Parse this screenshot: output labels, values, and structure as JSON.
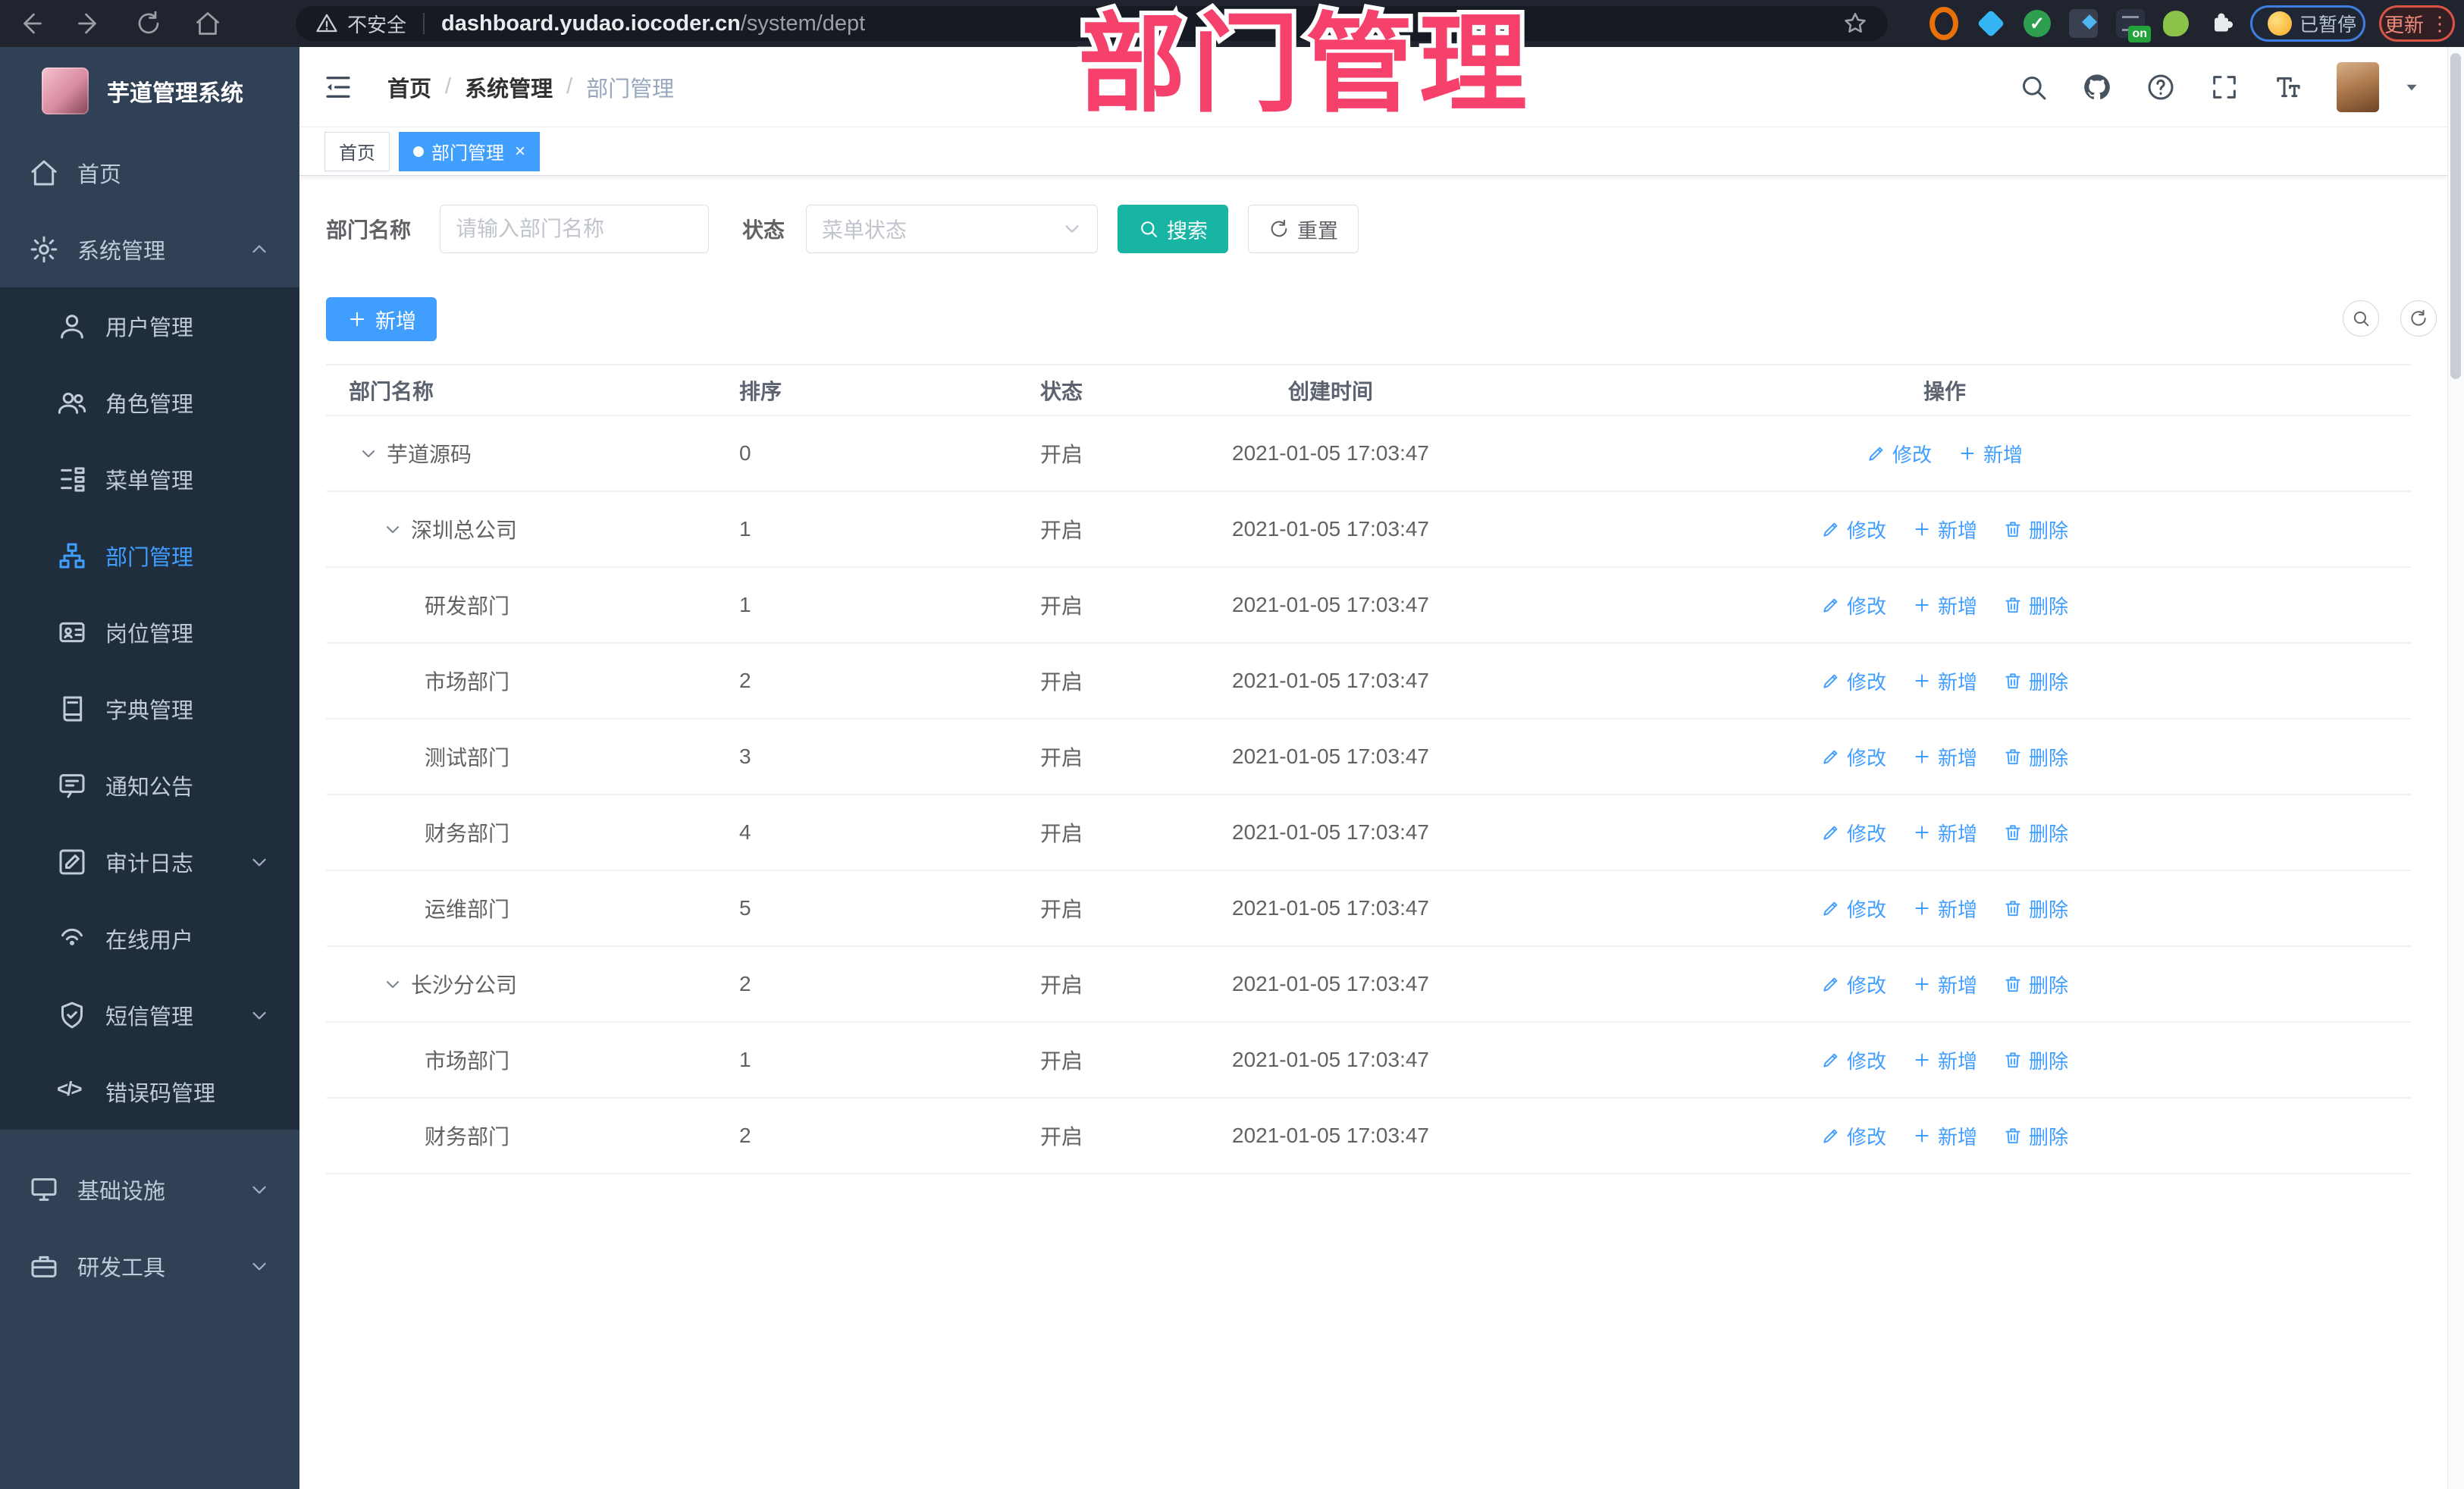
{
  "browser": {
    "security_label": "不安全",
    "url_host": "dashboard.yudao.iocoder.cn",
    "url_path": "/system/dept",
    "paused_label": "已暂停",
    "update_label": "更新",
    "extensions": [
      {
        "name": "orange-ring-extension-icon"
      },
      {
        "name": "blue-gem-extension-icon"
      },
      {
        "name": "green-check-extension-icon",
        "glyph": "✓"
      },
      {
        "name": "grid-extension-icon"
      },
      {
        "name": "toggle-extension-icon",
        "badge": "on"
      },
      {
        "name": "leaf-extension-icon"
      },
      {
        "name": "puzzle-extension-icon"
      }
    ]
  },
  "watermark": "部门管理",
  "sidebar": {
    "title": "芋道管理系统",
    "menu": [
      {
        "label": "首页",
        "icon": "home-icon",
        "kind": "top"
      },
      {
        "label": "系统管理",
        "icon": "gear-icon",
        "kind": "top",
        "chevron": "up"
      },
      {
        "label": "用户管理",
        "icon": "user-icon",
        "kind": "sub"
      },
      {
        "label": "角色管理",
        "icon": "users-icon",
        "kind": "sub"
      },
      {
        "label": "菜单管理",
        "icon": "menu-tree-icon",
        "kind": "sub"
      },
      {
        "label": "部门管理",
        "icon": "org-icon",
        "kind": "sub",
        "active": true
      },
      {
        "label": "岗位管理",
        "icon": "idcard-icon",
        "kind": "sub"
      },
      {
        "label": "字典管理",
        "icon": "dict-icon",
        "kind": "sub"
      },
      {
        "label": "通知公告",
        "icon": "notice-icon",
        "kind": "sub"
      },
      {
        "label": "审计日志",
        "icon": "audit-icon",
        "kind": "sub",
        "chevron": "down"
      },
      {
        "label": "在线用户",
        "icon": "online-icon",
        "kind": "sub"
      },
      {
        "label": "短信管理",
        "icon": "sms-icon",
        "kind": "sub",
        "chevron": "down"
      },
      {
        "label": "错误码管理",
        "icon": "code-icon",
        "kind": "sub"
      },
      {
        "label": "基础设施",
        "icon": "infra-icon",
        "kind": "top",
        "chevron": "down",
        "gap": true
      },
      {
        "label": "研发工具",
        "icon": "tools-icon",
        "kind": "top",
        "chevron": "down"
      }
    ]
  },
  "header": {
    "breadcrumb": [
      "首页",
      "系统管理",
      "部门管理"
    ]
  },
  "tags": [
    {
      "label": "首页",
      "active": false,
      "closable": false
    },
    {
      "label": "部门管理",
      "active": true,
      "closable": true
    }
  ],
  "filter": {
    "dept_label": "部门名称",
    "dept_placeholder": "请输入部门名称",
    "status_label": "状态",
    "status_placeholder": "菜单状态",
    "search_label": "搜索",
    "reset_label": "重置"
  },
  "toolbar": {
    "add_label": "新增"
  },
  "actions": {
    "edit": "修改",
    "add": "新增",
    "delete": "删除"
  },
  "table": {
    "columns": [
      "部门名称",
      "排序",
      "状态",
      "创建时间",
      "操作"
    ],
    "rows": [
      {
        "name": "芋道源码",
        "level": 0,
        "expandable": true,
        "sort": "0",
        "status": "开启",
        "created": "2021-01-05 17:03:47",
        "can_delete": false
      },
      {
        "name": "深圳总公司",
        "level": 1,
        "expandable": true,
        "sort": "1",
        "status": "开启",
        "created": "2021-01-05 17:03:47",
        "can_delete": true
      },
      {
        "name": "研发部门",
        "level": 2,
        "expandable": false,
        "sort": "1",
        "status": "开启",
        "created": "2021-01-05 17:03:47",
        "can_delete": true
      },
      {
        "name": "市场部门",
        "level": 2,
        "expandable": false,
        "sort": "2",
        "status": "开启",
        "created": "2021-01-05 17:03:47",
        "can_delete": true
      },
      {
        "name": "测试部门",
        "level": 2,
        "expandable": false,
        "sort": "3",
        "status": "开启",
        "created": "2021-01-05 17:03:47",
        "can_delete": true
      },
      {
        "name": "财务部门",
        "level": 2,
        "expandable": false,
        "sort": "4",
        "status": "开启",
        "created": "2021-01-05 17:03:47",
        "can_delete": true
      },
      {
        "name": "运维部门",
        "level": 2,
        "expandable": false,
        "sort": "5",
        "status": "开启",
        "created": "2021-01-05 17:03:47",
        "can_delete": true
      },
      {
        "name": "长沙分公司",
        "level": 1,
        "expandable": true,
        "sort": "2",
        "status": "开启",
        "created": "2021-01-05 17:03:47",
        "can_delete": true
      },
      {
        "name": "市场部门",
        "level": 2,
        "expandable": false,
        "sort": "1",
        "status": "开启",
        "created": "2021-01-05 17:03:47",
        "can_delete": true
      },
      {
        "name": "财务部门",
        "level": 2,
        "expandable": false,
        "sort": "2",
        "status": "开启",
        "created": "2021-01-05 17:03:47",
        "can_delete": true
      }
    ]
  },
  "colors": {
    "primary": "#409eff",
    "search_button": "#18b5a4",
    "watermark": "#f5416b",
    "sidebar_bg": "#304156",
    "submenu_bg": "#1f2d3d"
  }
}
